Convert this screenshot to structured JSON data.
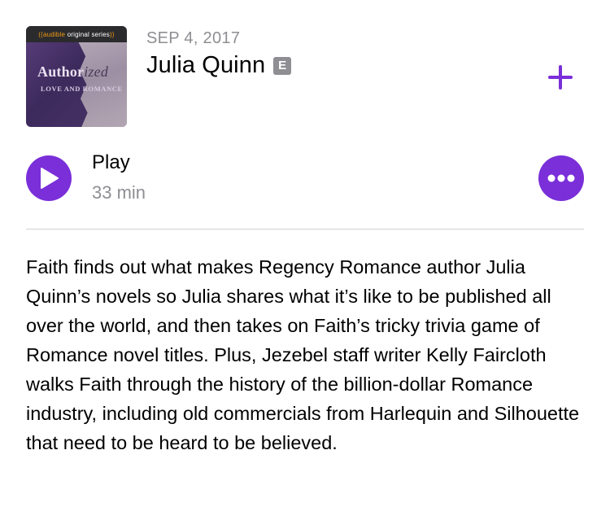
{
  "episode": {
    "date": "SEP 4, 2017",
    "title": "Julia Quinn",
    "explicit_badge": "E",
    "duration": "33 min",
    "description": "Faith finds out what makes Regency Romance author Julia Quinn’s novels so Julia shares what it’s like to be published all over the world, and then takes on Faith’s tricky trivia game of Romance novel titles. Plus, Jezebel staff writer Kelly Faircloth walks Faith through the history of the billion-dollar Romance industry, including old commercials from Harlequin and Silhouette that need to be heard to be believed."
  },
  "artwork": {
    "series_prefix": "audible",
    "series_suffix": "original series",
    "title_bold": "Author",
    "title_rest": "ized",
    "subtitle": "LOVE AND ROMANCE"
  },
  "controls": {
    "play_label": "Play",
    "add_icon": "plus-icon",
    "play_icon": "play-icon",
    "more_icon": "ellipsis-icon"
  },
  "colors": {
    "accent": "#7a2fd9",
    "secondary_text": "#8e8e93",
    "divider": "#d1d1d6"
  }
}
